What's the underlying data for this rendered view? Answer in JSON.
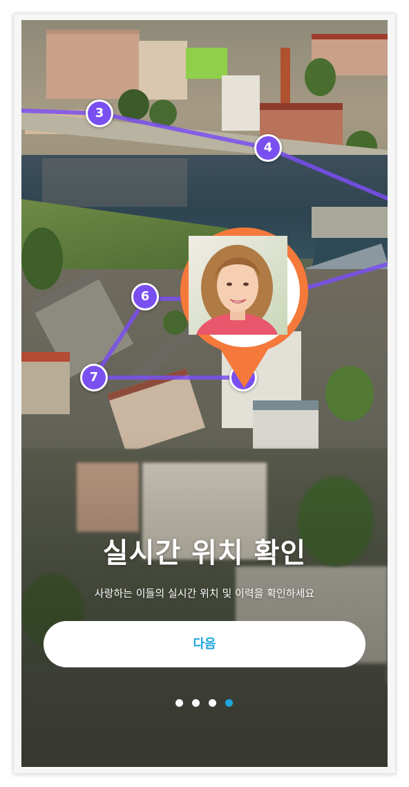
{
  "onboarding": {
    "title": "실시간 위치 확인",
    "subtitle": "사랑하는 이들의 실시간 위치 및 이력을 확인하세요",
    "next_label": "다음",
    "page_indicator": {
      "total": 4,
      "active_index": 3
    }
  },
  "route": {
    "stops": [
      "3",
      "4",
      "6",
      "7",
      "8"
    ]
  },
  "colors": {
    "route_purple": "#7a4ff0",
    "pin_orange": "#f5793b",
    "button_text_blue": "#1da5dc",
    "active_dot": "#1da5dc",
    "inactive_dot": "#ffffff"
  },
  "icons": {
    "location_pin": "map-pin-icon",
    "avatar": "user-photo"
  }
}
